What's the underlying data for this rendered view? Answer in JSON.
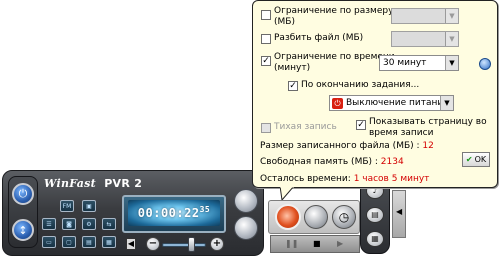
{
  "popup": {
    "size_limit": {
      "label": "Ограничение по размеру (МБ)",
      "line1": "Ограничение по размеру",
      "line2": "(МБ)",
      "checked": false,
      "value": ""
    },
    "split_file": {
      "label": "Разбить файл (МБ)",
      "checked": false,
      "value": ""
    },
    "time_limit": {
      "label": "Ограничение по времени (минут)",
      "line1": "Ограничение по времени",
      "line2": "(минут)",
      "checked": true,
      "value": "30 минут"
    },
    "on_finish": {
      "label": "По окончанию задания...",
      "checked": true
    },
    "finish_action": {
      "value": "Выключение питани"
    },
    "silent_record": {
      "label": "Тихая запись",
      "checked": false
    },
    "show_page": {
      "label": "Показывать страницу во время записи",
      "line1": "Показывать страницу во",
      "line2": "время записи",
      "checked": true
    },
    "recorded_size": {
      "label": "Размер записанного файла (МБ) :",
      "value": "12"
    },
    "free_memory": {
      "label": "Свободная память (МБ) :",
      "value": "2134"
    },
    "time_left": {
      "label": "Осталось времени:",
      "value": "1 часов 5 минут"
    },
    "ok_label": "OK"
  },
  "player": {
    "brand": "WinFast",
    "model": "PVR 2",
    "time_display": "00:00:22",
    "time_frames": "35",
    "volume_level": 0.7,
    "grid_buttons": {
      "fm": "FM"
    }
  },
  "icons": [
    "power-icon",
    "record-icon",
    "clock-icon",
    "mute-icon",
    "volume-minus-icon",
    "volume-plus-icon"
  ],
  "colors": {
    "popup_bg": "#fffde1",
    "accent_red": "#d40000",
    "lcd_blue": "#6fc7f0"
  }
}
